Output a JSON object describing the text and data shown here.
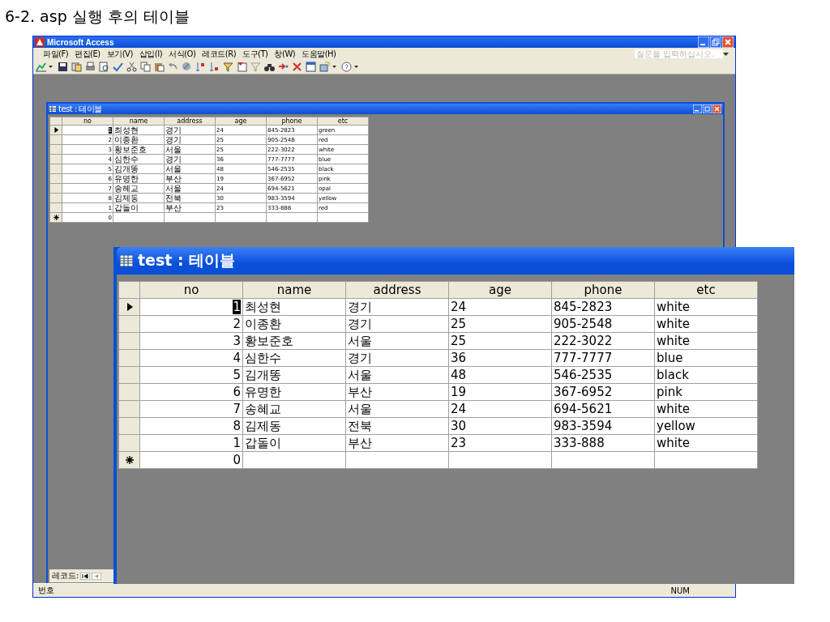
{
  "heading": "6-2.  asp 실행 후의 테이블",
  "window": {
    "title": "Microsoft Access",
    "help_box": {
      "placeholder": "질문을 입력하십시오."
    }
  },
  "menu": [
    "파일(F)",
    "편집(E)",
    "보기(V)",
    "삽입(I)",
    "서식(O)",
    "레코드(R)",
    "도구(T)",
    "창(W)",
    "도움말(H)"
  ],
  "status_bar": {
    "left": "번호",
    "right": "NUM"
  },
  "table_window": {
    "title": "test : 테이블",
    "record_label": "레코드:",
    "columns": [
      "no",
      "name",
      "address",
      "age",
      "phone",
      "etc"
    ],
    "rows": [
      {
        "kind": "current",
        "caret": true,
        "cells": [
          "1",
          "최성현",
          "경기",
          "24",
          "845-2823",
          "green"
        ]
      },
      {
        "kind": "plain",
        "caret": false,
        "cells": [
          "2",
          "이종환",
          "경기",
          "25",
          "905-2548",
          "red"
        ]
      },
      {
        "kind": "plain",
        "caret": false,
        "cells": [
          "3",
          "황보준호",
          "서울",
          "25",
          "222-3022",
          "white"
        ]
      },
      {
        "kind": "plain",
        "caret": false,
        "cells": [
          "4",
          "심한수",
          "경기",
          "36",
          "777-7777",
          "blue"
        ]
      },
      {
        "kind": "plain",
        "caret": false,
        "cells": [
          "5",
          "김개똥",
          "서울",
          "48",
          "546-2535",
          "black"
        ]
      },
      {
        "kind": "plain",
        "caret": false,
        "cells": [
          "6",
          "유명한",
          "부산",
          "19",
          "367-6952",
          "pink"
        ]
      },
      {
        "kind": "plain",
        "caret": false,
        "cells": [
          "7",
          "송혜교",
          "서울",
          "24",
          "694-5621",
          "opal"
        ]
      },
      {
        "kind": "plain",
        "caret": false,
        "cells": [
          "8",
          "김제동",
          "전북",
          "30",
          "983-3594",
          "yellow"
        ]
      },
      {
        "kind": "plain",
        "caret": false,
        "cells": [
          "1",
          "갑돌이",
          "부산",
          "23",
          "333-888",
          "red"
        ]
      },
      {
        "kind": "new",
        "caret": false,
        "cells": [
          "0",
          "",
          "",
          "",
          "",
          ""
        ]
      }
    ]
  },
  "zoomed_window": {
    "title": "test : 테이블",
    "columns": [
      "no",
      "name",
      "address",
      "age",
      "phone",
      "etc"
    ],
    "rows": [
      {
        "kind": "current",
        "caret": true,
        "cells": [
          "1",
          "최성현",
          "경기",
          "24",
          "845-2823",
          "white"
        ]
      },
      {
        "kind": "plain",
        "caret": false,
        "cells": [
          "2",
          "이종환",
          "경기",
          "25",
          "905-2548",
          "white"
        ]
      },
      {
        "kind": "plain",
        "caret": false,
        "cells": [
          "3",
          "황보준호",
          "서울",
          "25",
          "222-3022",
          "white"
        ]
      },
      {
        "kind": "plain",
        "caret": false,
        "cells": [
          "4",
          "심한수",
          "경기",
          "36",
          "777-7777",
          "blue"
        ]
      },
      {
        "kind": "plain",
        "caret": false,
        "cells": [
          "5",
          "김개똥",
          "서울",
          "48",
          "546-2535",
          "black"
        ]
      },
      {
        "kind": "plain",
        "caret": false,
        "cells": [
          "6",
          "유명한",
          "부산",
          "19",
          "367-6952",
          "pink"
        ]
      },
      {
        "kind": "plain",
        "caret": false,
        "cells": [
          "7",
          "송혜교",
          "서울",
          "24",
          "694-5621",
          "white"
        ]
      },
      {
        "kind": "plain",
        "caret": false,
        "cells": [
          "8",
          "김제동",
          "전북",
          "30",
          "983-3594",
          "yellow"
        ]
      },
      {
        "kind": "plain",
        "caret": false,
        "cells": [
          "1",
          "갑돌이",
          "부산",
          "23",
          "333-888",
          "white"
        ]
      },
      {
        "kind": "new",
        "caret": false,
        "cells": [
          "0",
          "",
          "",
          "",
          "",
          ""
        ]
      }
    ]
  }
}
